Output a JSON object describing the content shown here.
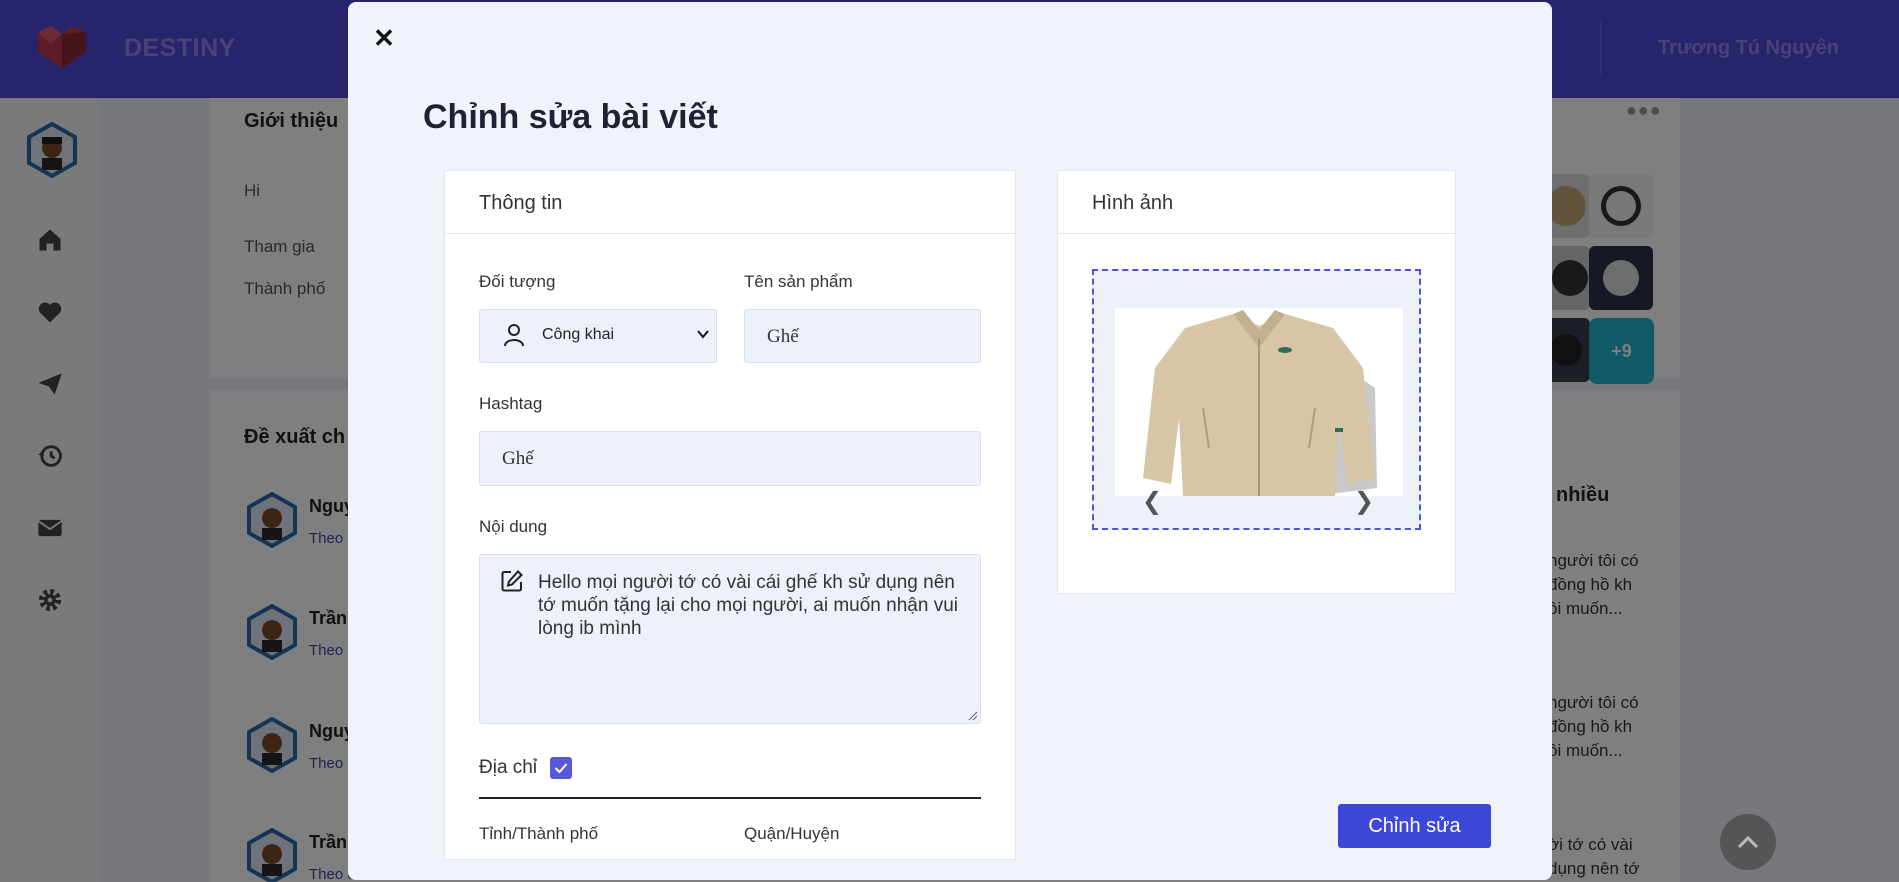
{
  "header": {
    "brand": "DESTINY",
    "user_name": "Trương Tú Nguyên"
  },
  "profile": {
    "intro_heading": "Giới thiệu",
    "bio": "Hi",
    "joined_label": "Tham gia",
    "city_label": "Thành phố"
  },
  "suggestions": {
    "heading": "Đề xuất ch",
    "items": [
      {
        "name": "Nguy",
        "sub": "Theo"
      },
      {
        "name": "Trần",
        "sub": "Theo"
      },
      {
        "name": "Nguy",
        "sub": "Theo"
      },
      {
        "name": "Trần",
        "sub": "Theo d"
      }
    ]
  },
  "right_column": {
    "more_count": "+9",
    "popular_heading": "nhiều",
    "posts": [
      [
        "người tôi có",
        "đồng hồ kh",
        "ôi muốn..."
      ],
      [
        "người tôi có",
        "đồng hồ kh",
        "ôi muốn..."
      ],
      [
        "ời tớ có vài",
        "dụng nên tớ"
      ]
    ]
  },
  "modal": {
    "close_symbol": "✕",
    "title": "Chỉnh sửa bài viết",
    "info_panel": {
      "title": "Thông tin",
      "audience_label": "Đối tượng",
      "audience_value": "Công khai",
      "product_label": "Tên sản phẩm",
      "product_value": "Ghế",
      "hashtag_label": "Hashtag",
      "hashtag_value": "Ghế",
      "content_label": "Nội dung",
      "content_value": "Hello mọi người tớ có vài cái ghế kh sử dụng nên tớ muốn tặng lại cho mọi người, ai muốn nhận vui lòng ib mình",
      "address_label": "Địa chỉ",
      "address_checked": true,
      "province_label": "Tỉnh/Thành phố",
      "district_label": "Quận/Huyện"
    },
    "image_panel": {
      "title": "Hình ảnh",
      "prev_arrow": "❮",
      "next_arrow": "❯"
    },
    "submit_label": "Chỉnh sửa"
  },
  "colors": {
    "primary": "#4f48d8",
    "button": "#3d47d8",
    "checkbox": "#5659d9",
    "badge": "#1fb5c8"
  }
}
